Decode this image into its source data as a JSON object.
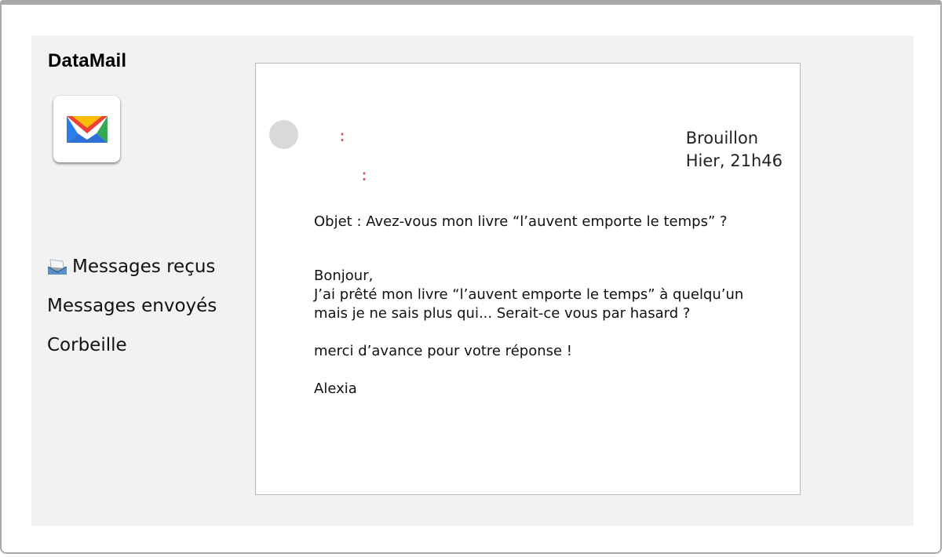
{
  "app": {
    "brand": "DataMail",
    "icon": "envelope-icon"
  },
  "sidebar": {
    "items": [
      {
        "label": "Messages reçus",
        "icon": "inbox-icon"
      },
      {
        "label": "Messages envoyés"
      },
      {
        "label": "Corbeille"
      }
    ]
  },
  "email": {
    "status": "Brouillon",
    "date": "Hier, 21h46",
    "from_separator": ":",
    "to_separator": ":",
    "subject": "Objet : Avez-vous mon livre “l’auvent emporte le temps” ?",
    "body": {
      "greeting": "Bonjour,",
      "line1": "J’ai prêté mon livre “l’auvent emporte le temps” à quelqu’un",
      "line2": "mais je ne sais plus qui... Serait-ce vous par hasard ?",
      "line3": "merci d’avance pour votre réponse !",
      "signature": "Alexia"
    }
  },
  "colors": {
    "panel_bg": "#f2f2f2",
    "avatar": "#d9d9d9",
    "separator": "#d9534f"
  }
}
